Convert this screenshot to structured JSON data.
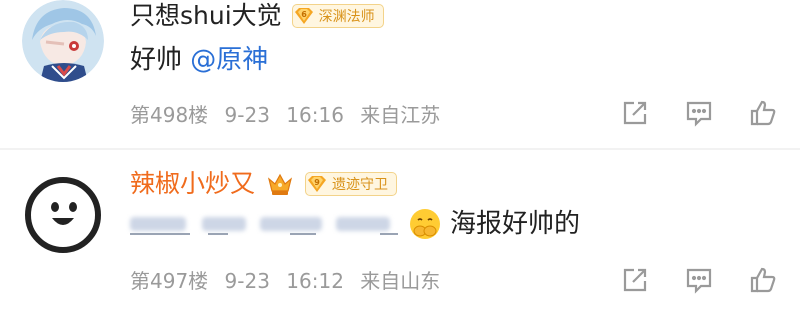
{
  "comments": [
    {
      "username": "只想shui大觉",
      "badge_level": "6",
      "badge_text": "深渊法师",
      "text": "好帅",
      "mention": "@原神",
      "floor": "第498楼",
      "date": "9-23",
      "time": "16:16",
      "location": "来自江苏"
    },
    {
      "username": "辣椒小炒又",
      "badge_level": "9",
      "badge_text": "遗迹守卫",
      "text": "海报好帅的",
      "floor": "第497楼",
      "date": "9-23",
      "time": "16:12",
      "location": "来自山东"
    }
  ],
  "colors": {
    "mention": "#2a6fd6",
    "vip_username": "#f06b1c",
    "badge_text": "#d9931b",
    "meta_gray": "#9a9a9a"
  },
  "icons": [
    "share-icon",
    "reply-icon",
    "like-icon",
    "crown-icon",
    "hands-over-mouth-emoji"
  ]
}
